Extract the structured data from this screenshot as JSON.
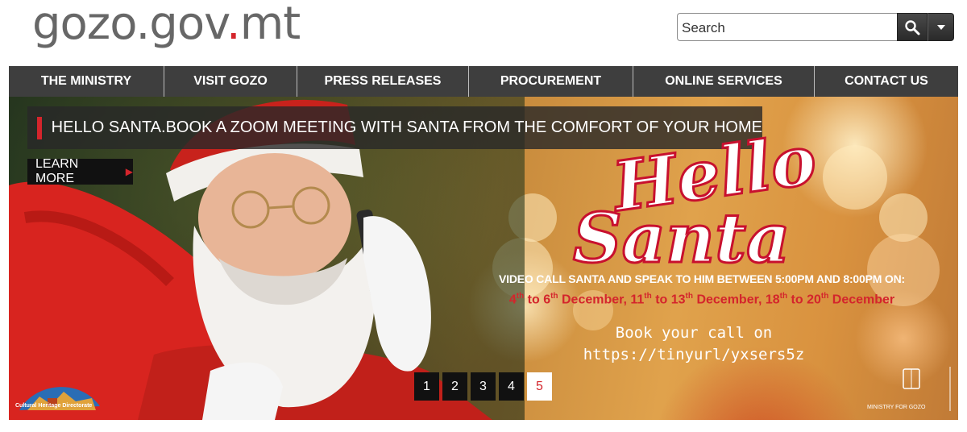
{
  "header": {
    "logo_pre": "gozo.gov",
    "logo_dot": ".",
    "logo_post": "mt",
    "search": {
      "placeholder": "Search"
    }
  },
  "nav": {
    "items": [
      {
        "label": "THE MINISTRY"
      },
      {
        "label": "VISIT GOZO"
      },
      {
        "label": "PRESS RELEASES"
      },
      {
        "label": "PROCUREMENT"
      },
      {
        "label": "ONLINE SERVICES"
      },
      {
        "label": "CONTACT US"
      }
    ]
  },
  "banner": {
    "headline": "HELLO SANTA.BOOK A ZOOM MEETING WITH SANTA FROM THE COMFORT OF YOUR HOME",
    "learn_more": "LEARN MORE",
    "hello_line1": "Hello",
    "hello_line2": "Santa",
    "call_line": "VIDEO CALL SANTA AND SPEAK TO HIM BETWEEN 5:00PM AND 8:00PM ON:",
    "dates": {
      "a1": "4",
      "a1s": "th",
      "a2": " to 6",
      "a2s": "th",
      "a3": " December, 11",
      "a3s": "th",
      "a4": " to 13",
      "a4s": "th",
      "a5": " December, 18",
      "a5s": "th",
      "a6": " to 20",
      "a6s": "th",
      "a7": " December"
    },
    "book_line1": "Book your call on",
    "book_line2": "https://tinyurl/yxsers5z",
    "chd_label": "Cultural Heritage Directorate",
    "mfg_label": "MINISTRY FOR GOZO",
    "pages": [
      "1",
      "2",
      "3",
      "4",
      "5"
    ],
    "active_page": "5"
  },
  "colors": {
    "accent": "#d4252c",
    "nav_bg": "#3e3e3e",
    "logo_text": "#676767"
  }
}
